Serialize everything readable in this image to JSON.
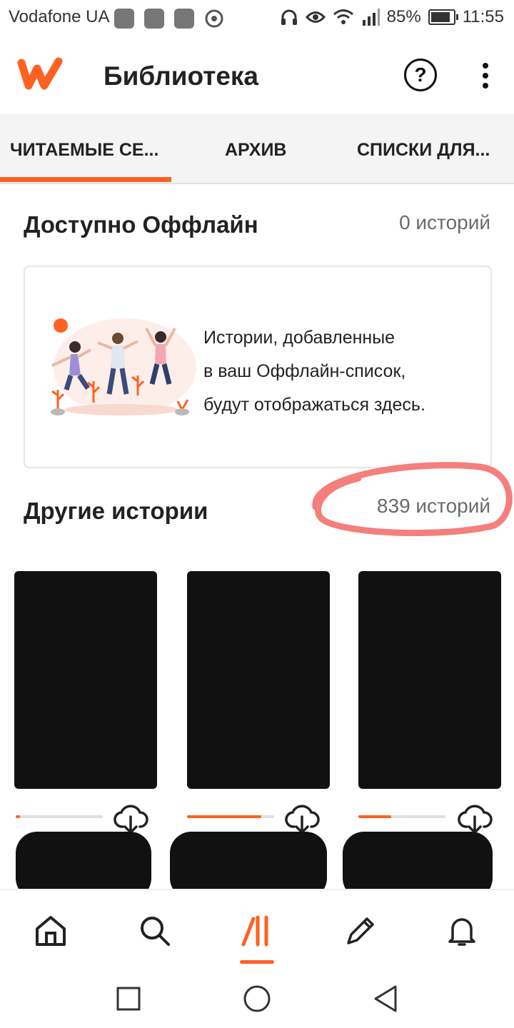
{
  "status_bar": {
    "carrier": "Vodafone UA",
    "battery": "85%",
    "time": "11:55",
    "icons": [
      "notification-icon",
      "notification-icon",
      "notification-icon",
      "cast-icon",
      "headphones-icon",
      "eye-icon",
      "wifi-icon",
      "signal-icon",
      "battery-icon"
    ]
  },
  "app_bar": {
    "logo": "wattpad-logo",
    "title": "Библиотека",
    "help_glyph": "?"
  },
  "tabs": [
    {
      "label": "ЧИТАЕМЫЕ СЕ..."
    },
    {
      "label": "АРХИВ"
    },
    {
      "label": "СПИСКИ ДЛЯ..."
    }
  ],
  "offline": {
    "title": "Доступно Оффлайн",
    "count": "0 историй",
    "message_lines": [
      "Истории, добавленные",
      "в ваш Оффлайн-список,",
      "будут отображаться здесь."
    ]
  },
  "other": {
    "title": "Другие истории",
    "count": "839 историй",
    "stories_progress": [
      0.05,
      0.85,
      0.38
    ]
  },
  "bottom_nav": [
    "home-icon",
    "search-icon",
    "library-icon",
    "write-icon",
    "notifications-icon"
  ],
  "colors": {
    "accent": "#ff6122",
    "annotation_circle": "#f47f7c",
    "redaction": "#111111"
  }
}
